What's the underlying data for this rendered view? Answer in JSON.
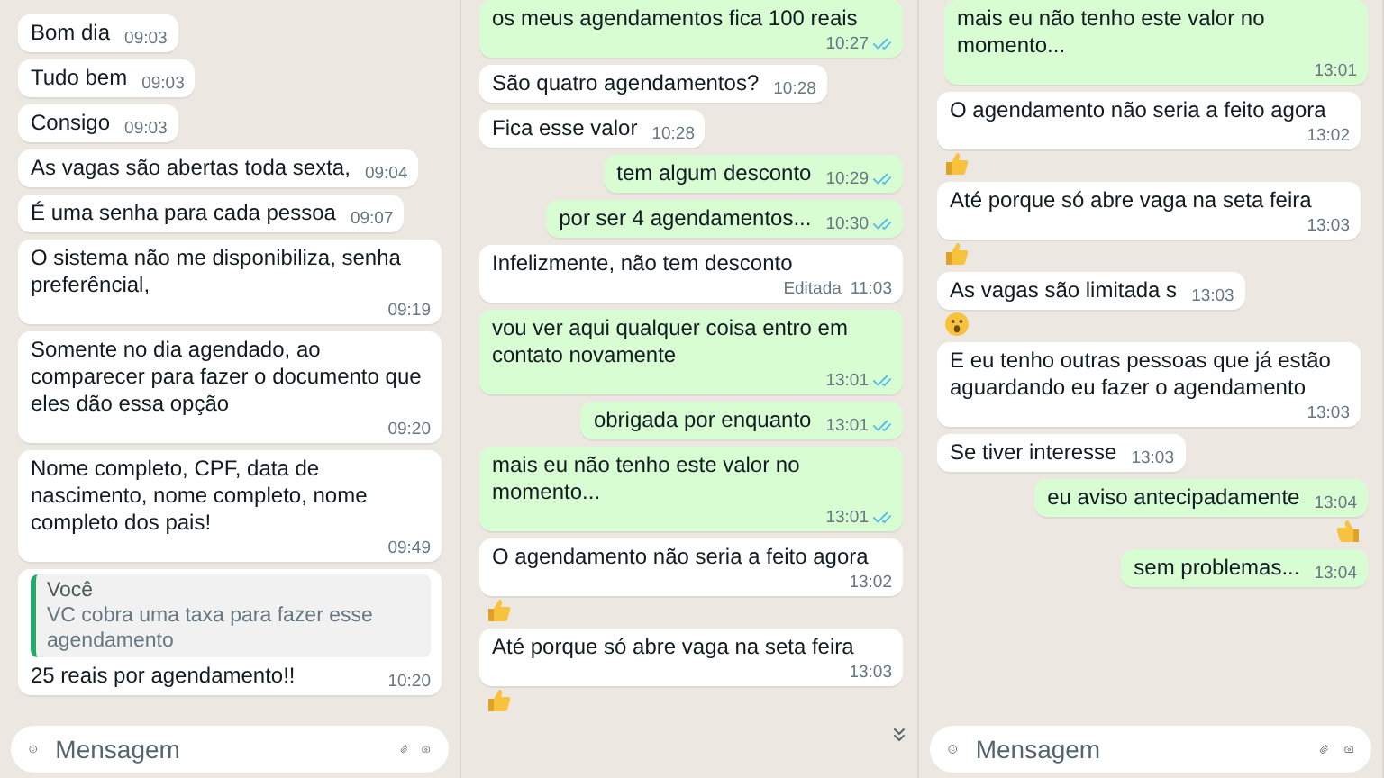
{
  "panels": [
    {
      "messages": [
        {
          "kind": "message",
          "outgoing": false,
          "text": "Bom dia",
          "time": "09:03"
        },
        {
          "kind": "message",
          "outgoing": false,
          "text": "Tudo bem",
          "time": "09:03"
        },
        {
          "kind": "message",
          "outgoing": false,
          "text": "Consigo",
          "time": "09:03"
        },
        {
          "kind": "message",
          "outgoing": false,
          "text": "As vagas são abertas toda sexta,",
          "time": "09:04"
        },
        {
          "kind": "message",
          "outgoing": false,
          "text": "É uma senha para cada pessoa",
          "time": "09:07"
        },
        {
          "kind": "message",
          "outgoing": false,
          "text": "O sistema não me disponibiliza, senha preferêncial,",
          "time": "09:19"
        },
        {
          "kind": "message",
          "outgoing": false,
          "text": "Somente no dia agendado, ao comparecer para fazer o documento que eles dão essa opção",
          "time": "09:20"
        },
        {
          "kind": "message",
          "outgoing": false,
          "text": "Nome completo, CPF, data de nascimento, nome completo, nome completo dos pais!",
          "time": "09:49"
        },
        {
          "kind": "quote",
          "outgoing": false,
          "author": "Você",
          "quoted": "VC cobra uma taxa para fazer esse agendamento",
          "text": "25 reais por agendamento!!",
          "time": "10:20"
        }
      ],
      "composer": {
        "placeholder": "Mensagem"
      }
    },
    {
      "messages": [
        {
          "kind": "message",
          "outgoing": true,
          "text": "os meus agendamentos fica 100 reais",
          "time": "10:27",
          "read": true
        },
        {
          "kind": "message",
          "outgoing": false,
          "text": "São quatro agendamentos?",
          "time": "10:28"
        },
        {
          "kind": "message",
          "outgoing": false,
          "text": "Fica esse valor",
          "time": "10:28"
        },
        {
          "kind": "message",
          "outgoing": true,
          "text": "tem algum desconto",
          "time": "10:29",
          "read": true
        },
        {
          "kind": "message",
          "outgoing": true,
          "text": "por ser 4 agendamentos...",
          "time": "10:30",
          "read": true
        },
        {
          "kind": "message",
          "outgoing": false,
          "text": "Infelizmente, não tem desconto",
          "edited": "Editada",
          "time": "11:03"
        },
        {
          "kind": "message",
          "outgoing": true,
          "text": "vou ver aqui qualquer coisa entro em contato novamente",
          "time": "13:01",
          "read": true
        },
        {
          "kind": "message",
          "outgoing": true,
          "text": "obrigada por enquanto",
          "time": "13:01",
          "read": true
        },
        {
          "kind": "message",
          "outgoing": true,
          "text": "mais eu não tenho este valor no momento...",
          "time": "13:01",
          "read": true
        },
        {
          "kind": "message",
          "outgoing": false,
          "text": "O agendamento não seria a feito agora",
          "time": "13:02"
        },
        {
          "kind": "thumbs-up-reaction",
          "outgoing": false
        },
        {
          "kind": "message",
          "outgoing": false,
          "text": "Até porque só abre vaga na seta feira",
          "time": "13:03"
        },
        {
          "kind": "thumbs-up-reaction",
          "outgoing": false
        }
      ],
      "scroll_down_button": true
    },
    {
      "messages": [
        {
          "kind": "message",
          "outgoing": true,
          "text": "mais eu não tenho este valor no momento...",
          "time": "13:01",
          "read": false
        },
        {
          "kind": "message",
          "outgoing": false,
          "text": "O agendamento não seria a feito agora",
          "time": "13:02"
        },
        {
          "kind": "thumbs-up-reaction",
          "outgoing": false
        },
        {
          "kind": "message",
          "outgoing": false,
          "text": "Até porque só abre vaga na seta feira",
          "time": "13:03"
        },
        {
          "kind": "thumbs-up-reaction",
          "outgoing": false
        },
        {
          "kind": "message",
          "outgoing": false,
          "text": "As vagas são limitada s",
          "time": "13:03"
        },
        {
          "kind": "surprised-reaction",
          "outgoing": false
        },
        {
          "kind": "message",
          "outgoing": false,
          "text": "E eu tenho outras pessoas que já estão aguardando eu fazer o agendamento",
          "time": "13:03"
        },
        {
          "kind": "message",
          "outgoing": false,
          "text": "Se tiver interesse",
          "time": "13:03"
        },
        {
          "kind": "message",
          "outgoing": true,
          "text": "eu aviso antecipadamente",
          "time": "13:04",
          "read": false
        },
        {
          "kind": "thumbs-up-reaction",
          "outgoing": true
        },
        {
          "kind": "message",
          "outgoing": true,
          "text": "sem problemas...",
          "time": "13:04",
          "read": false
        }
      ],
      "composer": {
        "placeholder": "Mensagem"
      }
    }
  ]
}
